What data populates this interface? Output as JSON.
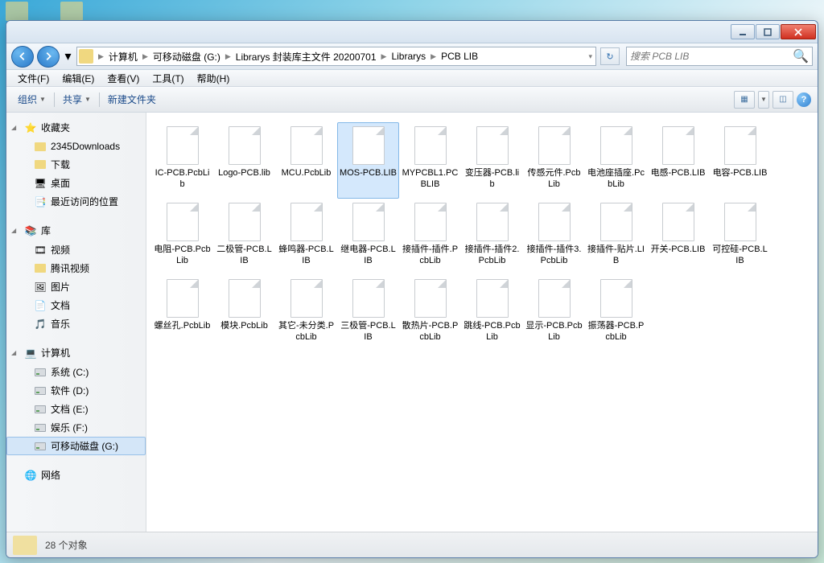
{
  "breadcrumb": [
    "计算机",
    "可移动磁盘 (G:)",
    "Librarys 封装库主文件 20200701",
    "Librarys",
    "PCB LIB"
  ],
  "search": {
    "placeholder": "搜索 PCB LIB"
  },
  "menus": {
    "file": "文件(F)",
    "edit": "编辑(E)",
    "view": "查看(V)",
    "tools": "工具(T)",
    "help": "帮助(H)"
  },
  "toolbar": {
    "organize": "组织",
    "share": "共享",
    "newfolder": "新建文件夹"
  },
  "sidebar": {
    "fav": {
      "label": "收藏夹",
      "items": [
        "2345Downloads",
        "下载",
        "桌面",
        "最近访问的位置"
      ]
    },
    "lib": {
      "label": "库",
      "items": [
        "视频",
        "腾讯视频",
        "图片",
        "文档",
        "音乐"
      ]
    },
    "comp": {
      "label": "计算机",
      "items": [
        "系统 (C:)",
        "软件 (D:)",
        "文档 (E:)",
        "娱乐 (F:)",
        "可移动磁盘 (G:)"
      ]
    },
    "net": {
      "label": "网络"
    }
  },
  "files": [
    "IC-PCB.PcbLib",
    "Logo-PCB.lib",
    "MCU.PcbLib",
    "MOS-PCB.LIB",
    "MYPCBL1.PCBLIB",
    "变压器-PCB.lib",
    "传感元件.PcbLib",
    "电池座插座.PcbLib",
    "电感-PCB.LIB",
    "电容-PCB.LIB",
    "电阻-PCB.PcbLib",
    "二极管-PCB.LIB",
    "蜂鸣器-PCB.LIB",
    "继电器-PCB.LIB",
    "接插件-插件.PcbLib",
    "接插件-插件2.PcbLib",
    "接插件-插件3.PcbLib",
    "接插件-贴片.LIB",
    "开关-PCB.LIB",
    "可控硅-PCB.LIB",
    "螺丝孔.PcbLib",
    "模块.PcbLib",
    "其它-未分类.PcbLib",
    "三极管-PCB.LIB",
    "散热片-PCB.PcbLib",
    "跳线-PCB.PcbLib",
    "显示-PCB.PcbLib",
    "振荡器-PCB.PcbLib"
  ],
  "selected_file_index": 3,
  "status": {
    "text": "28 个对象"
  }
}
